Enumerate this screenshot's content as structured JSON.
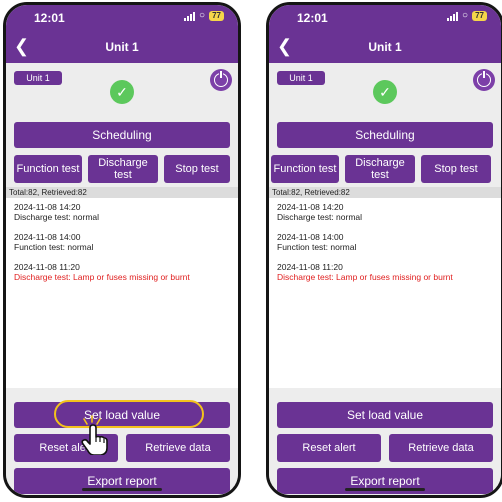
{
  "screens": [
    {
      "status": {
        "time": "12:01",
        "battery": "77"
      },
      "nav": {
        "back_icon": "chevron-left-icon",
        "title": "Unit 1"
      },
      "unit_chip": "Unit 1",
      "scheduling": "Scheduling",
      "function_test": "Function test",
      "discharge_test": "Discharge test",
      "stop_test": "Stop test",
      "totals": "Total:82, Retrieved:82",
      "log": [
        {
          "time": "2024-11-08 14:20",
          "desc": "Discharge test: normal"
        },
        {
          "time": "2024-11-08 14:00",
          "desc": "Function test: normal"
        },
        {
          "time": "2024-11-08 11:20",
          "desc": "Discharge test: Lamp or fuses missing or burnt"
        }
      ],
      "set_load": "Set load value",
      "reset_alert": "Reset alert",
      "retrieve_data": "Retrieve data",
      "export_report": "Export report"
    },
    {
      "status": {
        "time": "12:01",
        "battery": "77"
      },
      "nav": {
        "back_icon": "chevron-left-icon",
        "title": "Unit 1"
      },
      "unit_chip": "Unit 1",
      "scheduling": "Scheduling",
      "function_test": "Function test",
      "discharge_test": "Discharge test",
      "stop_test": "Stop test",
      "totals": "Total:82, Retrieved:82",
      "log": [
        {
          "time": "2024-11-08 14:20",
          "desc": "Discharge test: normal"
        },
        {
          "time": "2024-11-08 14:00",
          "desc": "Function test: normal"
        },
        {
          "time": "2024-11-08 11:20",
          "desc": "Discharge test: Lamp or fuses missing or burnt"
        }
      ],
      "set_load": "Set load value",
      "reset_alert": "Reset alert",
      "retrieve_data": "Retrieve data",
      "export_report": "Export report"
    }
  ],
  "colors": {
    "brand": "#6a3394",
    "ok": "#5cc85c",
    "error": "#e02020",
    "highlight": "#f3c21c"
  }
}
